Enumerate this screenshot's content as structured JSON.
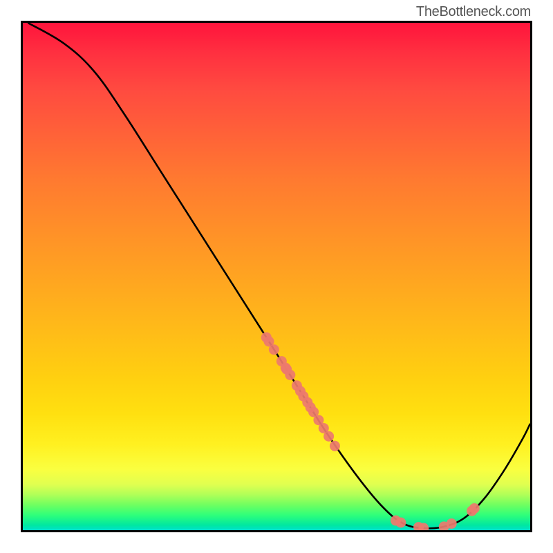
{
  "watermark": "TheBottleneck.com",
  "chart_data": {
    "type": "line",
    "title": "",
    "xlabel": "",
    "ylabel": "",
    "xlim": [
      0,
      100
    ],
    "ylim": [
      0,
      100
    ],
    "grid": false,
    "legend": false,
    "curve": [
      {
        "x": 1,
        "y": 100
      },
      {
        "x": 8,
        "y": 96
      },
      {
        "x": 14,
        "y": 90.5
      },
      {
        "x": 20,
        "y": 82
      },
      {
        "x": 27,
        "y": 71
      },
      {
        "x": 34,
        "y": 60
      },
      {
        "x": 41,
        "y": 49
      },
      {
        "x": 48,
        "y": 38
      },
      {
        "x": 54,
        "y": 28.5
      },
      {
        "x": 60,
        "y": 19
      },
      {
        "x": 66,
        "y": 10.5
      },
      {
        "x": 71,
        "y": 4.5
      },
      {
        "x": 75,
        "y": 1.3
      },
      {
        "x": 79,
        "y": 0.4
      },
      {
        "x": 83,
        "y": 0.7
      },
      {
        "x": 87,
        "y": 2.4
      },
      {
        "x": 91,
        "y": 6.3
      },
      {
        "x": 95,
        "y": 12
      },
      {
        "x": 98.5,
        "y": 18
      },
      {
        "x": 100,
        "y": 21
      }
    ],
    "markers": [
      {
        "x": 48.0,
        "y": 38.0
      },
      {
        "x": 48.5,
        "y": 37.2
      },
      {
        "x": 49.5,
        "y": 35.6
      },
      {
        "x": 51.0,
        "y": 33.3
      },
      {
        "x": 51.8,
        "y": 32.0
      },
      {
        "x": 52.0,
        "y": 31.7
      },
      {
        "x": 52.7,
        "y": 30.6
      },
      {
        "x": 54.0,
        "y": 28.5
      },
      {
        "x": 54.7,
        "y": 27.4
      },
      {
        "x": 55.3,
        "y": 26.4
      },
      {
        "x": 56.1,
        "y": 25.2
      },
      {
        "x": 56.7,
        "y": 24.2
      },
      {
        "x": 57.3,
        "y": 23.3
      },
      {
        "x": 58.3,
        "y": 21.7
      },
      {
        "x": 59.3,
        "y": 20.1
      },
      {
        "x": 60.3,
        "y": 18.5
      },
      {
        "x": 61.5,
        "y": 16.6
      },
      {
        "x": 73.5,
        "y": 1.9
      },
      {
        "x": 74.5,
        "y": 1.5
      },
      {
        "x": 78.0,
        "y": 0.6
      },
      {
        "x": 79.0,
        "y": 0.4
      },
      {
        "x": 83.0,
        "y": 0.7
      },
      {
        "x": 84.5,
        "y": 1.3
      },
      {
        "x": 88.5,
        "y": 3.8
      },
      {
        "x": 89.0,
        "y": 4.3
      }
    ],
    "marker_color": "#ed7a6e",
    "curve_color": "#000000",
    "background_gradient": {
      "top": "#ff143c",
      "mid": "#ffe010",
      "bottom": "#00e0cc"
    }
  }
}
